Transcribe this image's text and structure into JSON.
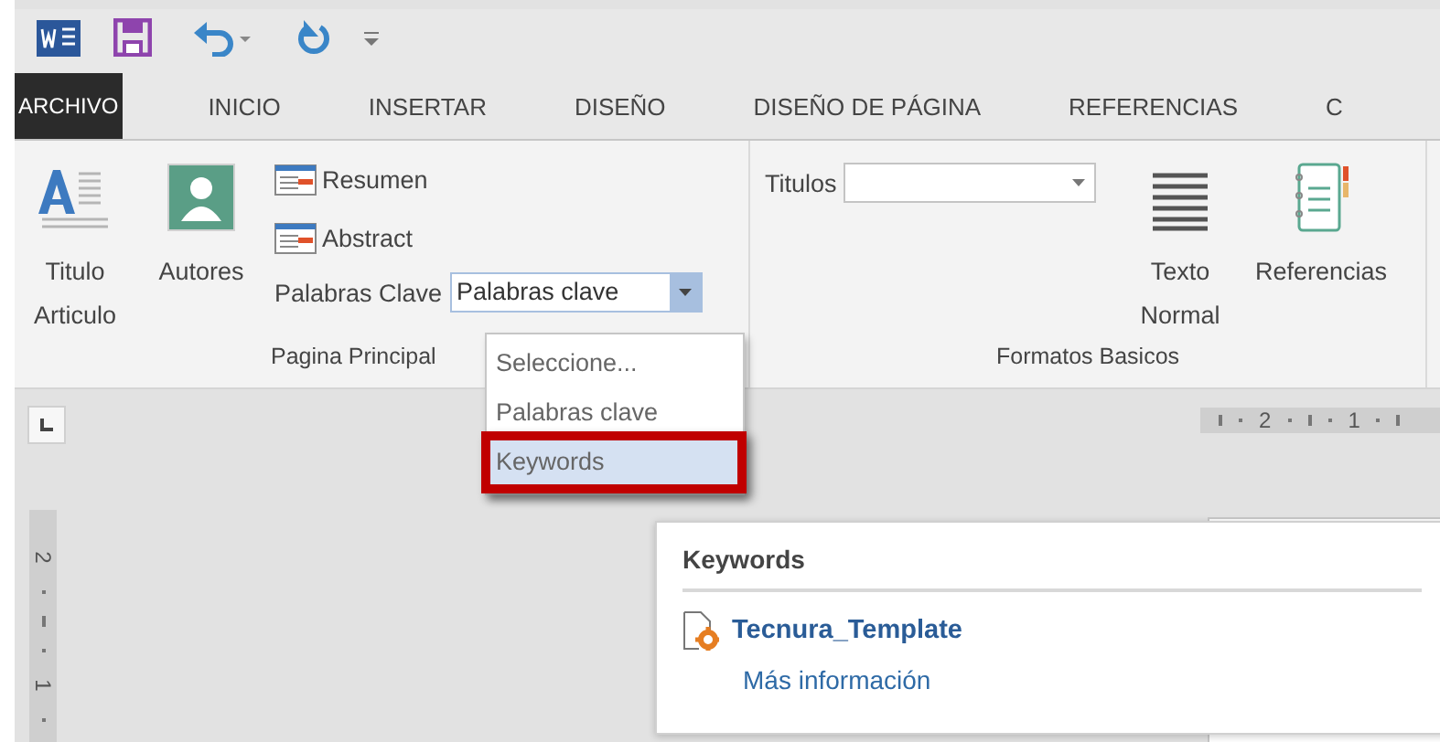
{
  "tabs": [
    {
      "label": "ARCHIVO",
      "kind": "file",
      "selected": false
    },
    {
      "label": "INICIO",
      "kind": "tab",
      "selected": false
    },
    {
      "label": "INSERTAR",
      "kind": "tab",
      "selected": false
    },
    {
      "label": "DISEÑO",
      "kind": "tab",
      "selected": false
    },
    {
      "label": "DISEÑO DE PÁGINA",
      "kind": "tab",
      "selected": false
    },
    {
      "label": "REFERENCIAS",
      "kind": "tab",
      "selected": false
    },
    {
      "label": "C",
      "kind": "tab",
      "selected": false
    }
  ],
  "ribbon": {
    "groups": [
      {
        "label": "Pagina Principal",
        "large_buttons": [
          {
            "label": "Titulo Articulo",
            "kind": "title"
          },
          {
            "label": "Autores",
            "kind": "person"
          }
        ],
        "small_buttons": [
          {
            "label": "Resumen"
          },
          {
            "label": "Abstract"
          }
        ],
        "combo": {
          "label": "Palabras Clave",
          "value": "Palabras clave",
          "open": true
        }
      },
      {
        "label": "Formatos Basicos",
        "combo": {
          "label": "Titulos",
          "open": false
        },
        "large_buttons": [
          {
            "label": "Texto Normal",
            "kind": "lines"
          },
          {
            "label": "Referencias",
            "kind": "notebook"
          }
        ]
      }
    ]
  },
  "dropdown": {
    "items": [
      {
        "label": "Seleccione...",
        "selected": false,
        "annotated": false
      },
      {
        "label": "Palabras clave",
        "selected": false,
        "annotated": false
      },
      {
        "label": "Keywords",
        "selected": true,
        "annotated": true
      }
    ]
  },
  "rulers": {
    "horizontal": [
      "2",
      "1"
    ],
    "vertical": [
      "2",
      "1"
    ]
  },
  "tooltip": {
    "title": "Keywords",
    "template": "Tecnura_Template",
    "link": "Más información"
  }
}
